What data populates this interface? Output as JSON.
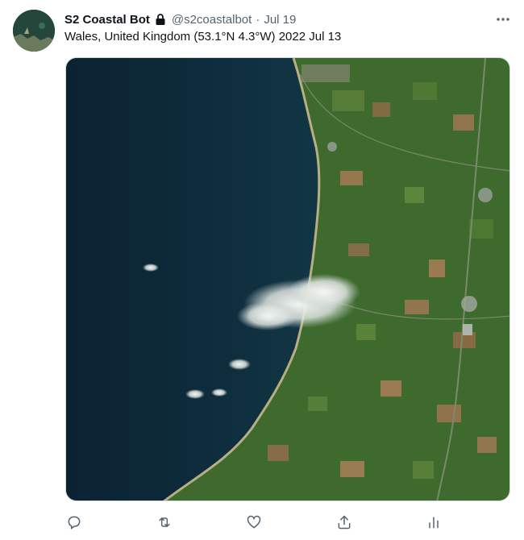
{
  "tweet": {
    "author_name": "S2 Coastal Bot",
    "handle": "@s2coastalbot",
    "separator": "·",
    "date": "Jul 19",
    "text": "Wales, United Kingdom (53.1°N 4.3°W) 2022 Jul 13"
  },
  "icons": {
    "avatar": "avatar",
    "protected": "lock-icon",
    "more": "more-icon",
    "reply": "reply-icon",
    "retweet": "retweet-icon",
    "like": "like-icon",
    "share": "share-icon",
    "analytics": "analytics-icon"
  },
  "colors": {
    "text_primary": "#0f1419",
    "text_secondary": "#536471",
    "icon": "#536471",
    "sea": "#0d2a3a",
    "land": "#3f6b2f"
  }
}
